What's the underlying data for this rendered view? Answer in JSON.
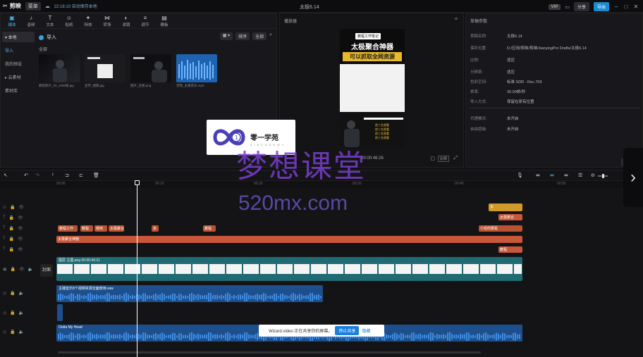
{
  "titlebar": {
    "app_name": "剪映",
    "menu_label": "菜单",
    "autosave": "22:18:10 自动保存本地",
    "project_title": "太极6.14",
    "vip": "VIP",
    "share": "分享",
    "export": "导出"
  },
  "toolbar": [
    {
      "label": "媒体",
      "icon": "▣"
    },
    {
      "label": "音频",
      "icon": "♪"
    },
    {
      "label": "文本",
      "icon": "T"
    },
    {
      "label": "贴纸",
      "icon": "☺"
    },
    {
      "label": "特效",
      "icon": "✦"
    },
    {
      "label": "转场",
      "icon": "⋈"
    },
    {
      "label": "滤镜",
      "icon": "◐"
    },
    {
      "label": "调节",
      "icon": "≡"
    },
    {
      "label": "模板",
      "icon": "▤"
    }
  ],
  "sidenav": [
    {
      "label": "▾ 本地"
    },
    {
      "label": "导入"
    },
    {
      "label": "我的预设"
    },
    {
      "label": "▸ 云素材"
    },
    {
      "label": "素材库"
    }
  ],
  "media": {
    "import_label": "导入",
    "all_label": "全部",
    "sort_label": "排序",
    "all_btn": "全部",
    "items": [
      {
        "caption": "教程照片_20_1080版.jpg"
      },
      {
        "caption": "宣传_图稿.jpg"
      },
      {
        "caption": "图片_主图.png"
      },
      {
        "caption": "音频_主播音乐.mp3"
      }
    ]
  },
  "player": {
    "title": "播放器",
    "timecode": "00:00:46:26",
    "phone_top_tag": "教程工作笔记",
    "phone_headline1": "太极聚合神器",
    "phone_headline2": "可以抓取全网资源",
    "phone_bottom": [
      "前三名观看",
      "前三名观看",
      "前三名观看",
      "前三名观看"
    ]
  },
  "props": {
    "title": "草稿参数",
    "rows": [
      {
        "k": "草稿名称:",
        "v": "太极6.14"
      },
      {
        "k": "保存位置:",
        "v": "D:/应用/剪映/剪映/JianyingPro Drafts/太极6.14"
      },
      {
        "k": "比例:",
        "v": "适应"
      },
      {
        "k": "分辨率:",
        "v": "适应"
      },
      {
        "k": "色彩空间:",
        "v": "标准 SDR - Rec.709"
      },
      {
        "k": "帧率:",
        "v": "30.00帧/秒"
      },
      {
        "k": "导入方式:",
        "v": "保留在原有位置"
      },
      {
        "k": "代理模式:",
        "v": "未开启"
      },
      {
        "k": "自由层级:",
        "v": "未开启"
      }
    ],
    "modify": "修改"
  },
  "timeline": {
    "cover_label": "封面",
    "ruler": [
      "00:00",
      "00:10",
      "00:20",
      "00:30",
      "00:40",
      "00:50",
      "01:00",
      "01:10"
    ],
    "main_clip": "图层 主图.png  00:00:46:21",
    "audio_clip": "主播音乐8个视频资源全面使用.wav",
    "music_clip": "Outta My Head",
    "text_clip": "太极聚合神器",
    "small_clips": [
      "教程工作",
      "教程",
      "使用",
      "太极聚合神器",
      "多",
      "教程",
      "转"
    ],
    "right_clips": [
      "太",
      "太极聚合",
      "介绍你要看",
      "教程",
      "太"
    ]
  },
  "overlays": {
    "logo_text": "零一学苑",
    "logo_sub": "A I  A C A D E M Y",
    "watermark_cn": "梦想课堂",
    "watermark_en": "520mx.com",
    "share_msg": "Wizard.video 正在共享你的屏幕。",
    "stop_share": "停止共享",
    "hide": "隐藏"
  }
}
